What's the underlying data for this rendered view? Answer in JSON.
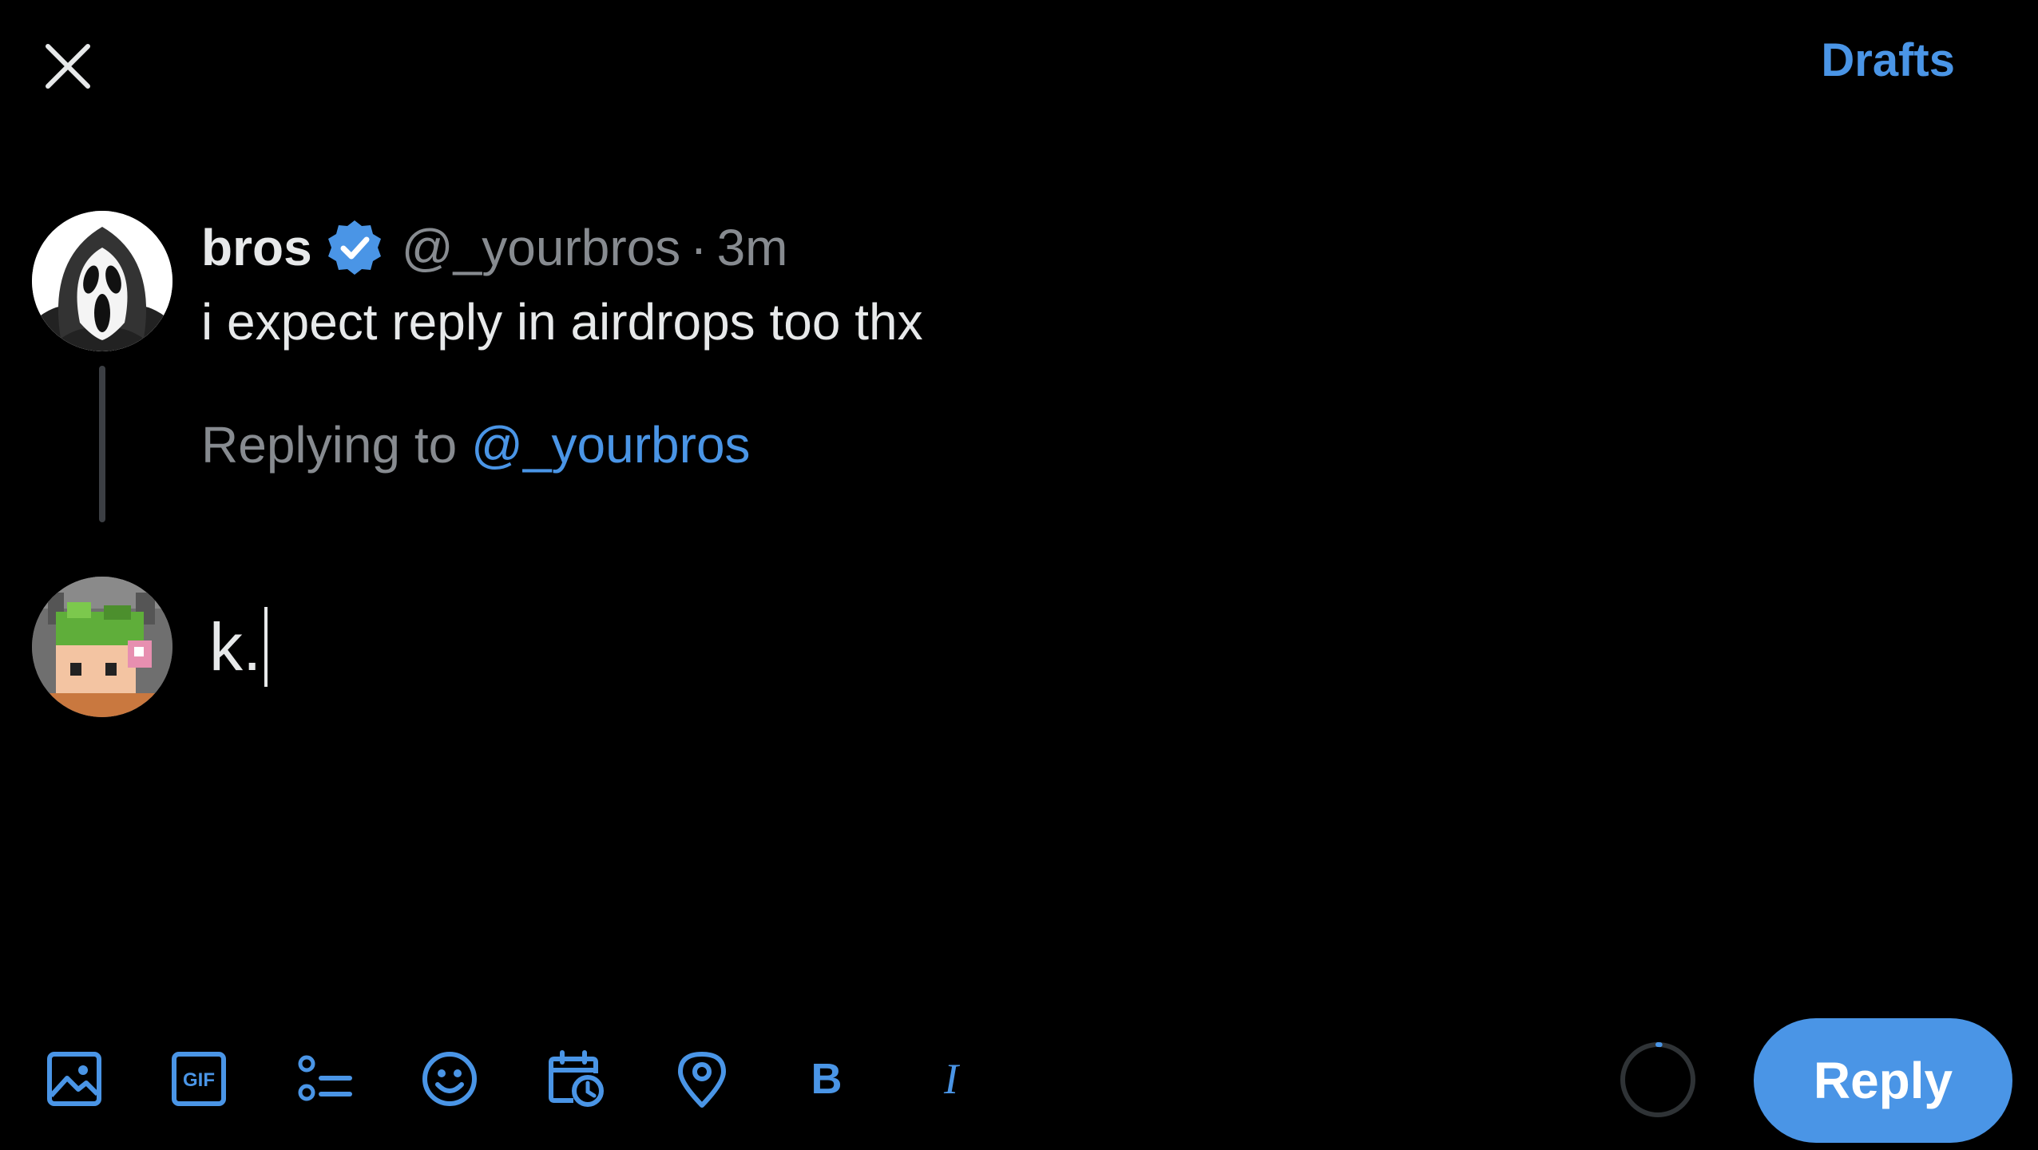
{
  "header": {
    "close_icon": "close-icon",
    "drafts_label": "Drafts",
    "accent_color": "#4a95e6"
  },
  "original_tweet": {
    "display_name": "bros",
    "verified_icon": "verified-badge-icon",
    "handle": "@_yourbros",
    "separator": "·",
    "time": "3m",
    "text": "i expect reply in airdrops too thx",
    "avatar": "ghostface-mask-avatar"
  },
  "replying_to": {
    "prefix": "Replying to",
    "handle": "@_yourbros"
  },
  "compose": {
    "value": "k.",
    "avatar": "pixel-art-avatar"
  },
  "toolbar": {
    "items": [
      {
        "name": "image-icon"
      },
      {
        "name": "gif-icon",
        "label": "GIF"
      },
      {
        "name": "poll-icon"
      },
      {
        "name": "emoji-icon"
      },
      {
        "name": "schedule-icon"
      },
      {
        "name": "location-icon"
      },
      {
        "name": "bold-icon",
        "label": "B"
      },
      {
        "name": "italic-icon",
        "label": "I"
      }
    ],
    "character_progress": 0.01,
    "reply_label": "Reply"
  }
}
